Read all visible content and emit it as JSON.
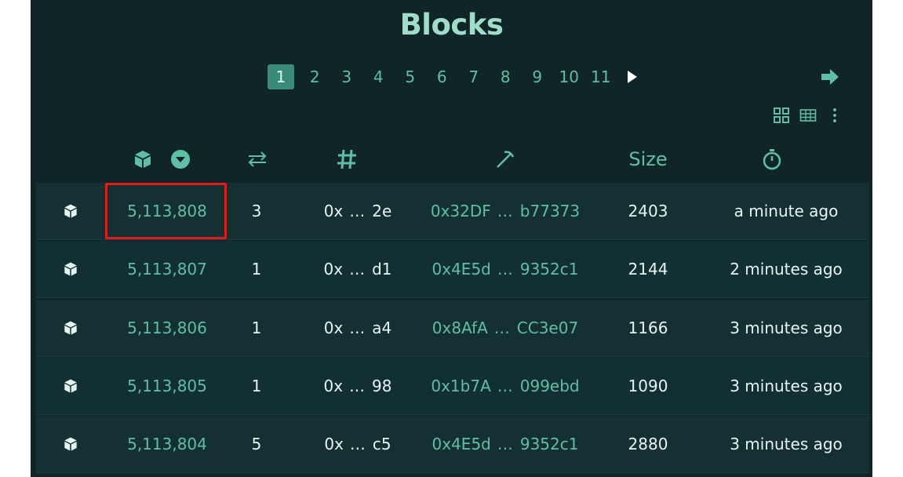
{
  "page": {
    "title": "Blocks"
  },
  "pagination": {
    "pages": [
      "1",
      "2",
      "3",
      "4",
      "5",
      "6",
      "7",
      "8",
      "9",
      "10",
      "11"
    ],
    "active": "1",
    "next_icon": "play-right-icon",
    "last_icon": "arrow-right-icon"
  },
  "view_tools": {
    "grid_icon": "grid-view-icon",
    "table_icon": "table-view-icon",
    "menu_icon": "more-vertical-icon"
  },
  "table": {
    "headers": {
      "block_icon": "cube-icon",
      "sort_icon": "sort-down-icon",
      "tx_icon": "swap-icon",
      "hash_icon": "hash-icon",
      "miner_icon": "pickaxe-icon",
      "size_label": "Size",
      "time_icon": "stopwatch-icon"
    },
    "rows": [
      {
        "number": "5,113,808",
        "tx": "3",
        "hash_start": "0x",
        "hash_end": "2e",
        "miner_start": "0x32DF",
        "miner_end": "b77373",
        "size": "2403",
        "age": "a minute ago"
      },
      {
        "number": "5,113,807",
        "tx": "1",
        "hash_start": "0x",
        "hash_end": "d1",
        "miner_start": "0x4E5d",
        "miner_end": "9352c1",
        "size": "2144",
        "age": "2 minutes ago"
      },
      {
        "number": "5,113,806",
        "tx": "1",
        "hash_start": "0x",
        "hash_end": "a4",
        "miner_start": "0x8AfA",
        "miner_end": "CC3e07",
        "size": "1166",
        "age": "3 minutes ago"
      },
      {
        "number": "5,113,805",
        "tx": "1",
        "hash_start": "0x",
        "hash_end": "98",
        "miner_start": "0x1b7A",
        "miner_end": "099ebd",
        "size": "1090",
        "age": "3 minutes ago"
      },
      {
        "number": "5,113,804",
        "tx": "5",
        "hash_start": "0x",
        "hash_end": "c5",
        "miner_start": "0x4E5d",
        "miner_end": "9352c1",
        "size": "2880",
        "age": "3 minutes ago"
      }
    ],
    "ellipsis": "…"
  },
  "colors": {
    "background": "#0f2527",
    "accent": "#5fbfa4",
    "title": "#9fdcc9",
    "text": "#e6f4f1",
    "highlight": "#e21a1a"
  }
}
